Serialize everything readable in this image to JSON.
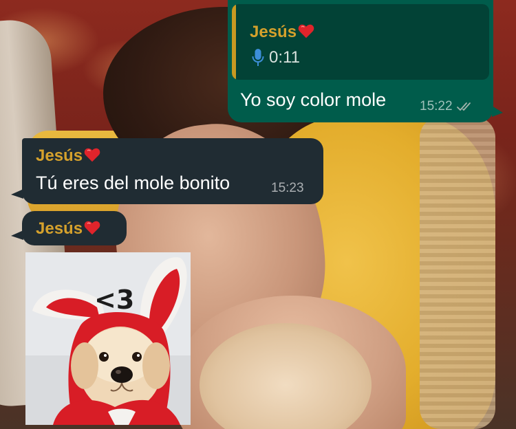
{
  "chat": {
    "outgoing": {
      "reply_author": "Jesús",
      "reply_duration": "0:11",
      "text": "Yo soy color mole",
      "time": "15:22"
    },
    "incoming_text": {
      "author": "Jesús",
      "text": "Tú eres del mole bonito",
      "time": "15:23"
    },
    "incoming_sticker": {
      "author": "Jesús",
      "sticker_text": "<3"
    }
  },
  "colors": {
    "outgoing_bubble": "#005c4b",
    "incoming_bubble": "#202c33",
    "author_name": "#d5a12c",
    "read_ticks": "#a6b4ae",
    "heart": "#e0242b"
  },
  "icons": [
    "red-heart-icon",
    "microphone-icon",
    "double-check-icon"
  ]
}
